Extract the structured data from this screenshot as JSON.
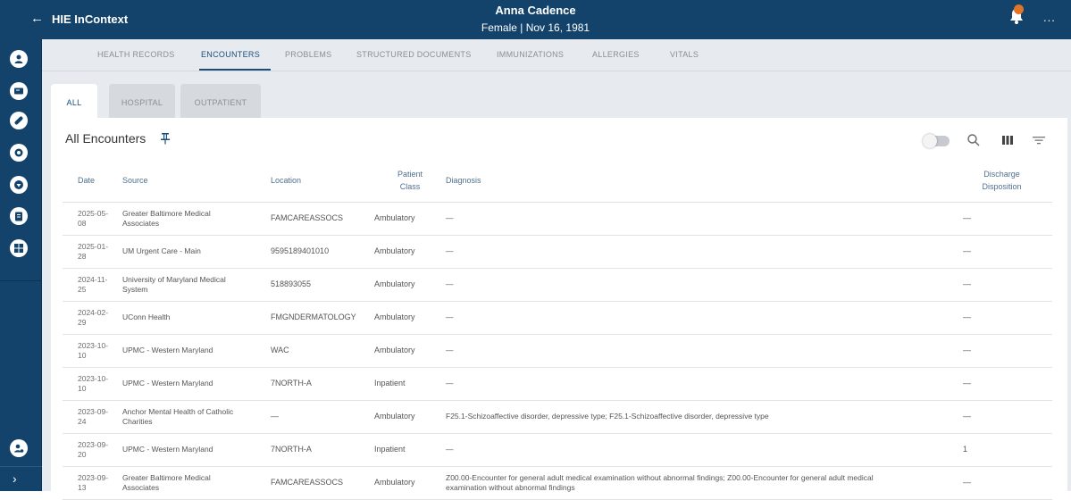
{
  "header": {
    "app_title": "HIE InContext",
    "patient_name": "Anna Cadence",
    "patient_meta": "Female | Nov 16, 1981",
    "more_label": "..."
  },
  "nav": {
    "tabs": [
      "HEALTH RECORDS",
      "ENCOUNTERS",
      "PROBLEMS",
      "STRUCTURED DOCUMENTS",
      "IMMUNIZATIONS",
      "ALLERGIES",
      "VITALS"
    ],
    "active": "ENCOUNTERS"
  },
  "subtabs": [
    "ALL",
    "HOSPITAL",
    "OUTPATIENT"
  ],
  "panel": {
    "title": "All Encounters"
  },
  "table": {
    "headers": {
      "date": "Date",
      "source": "Source",
      "location": "Location",
      "patient_class_1": "Patient",
      "patient_class_2": "Class",
      "diagnosis": "Diagnosis",
      "discharge_1": "Discharge",
      "discharge_2": "Disposition"
    },
    "rows": [
      {
        "date1": "2025-05-",
        "date2": "08",
        "source": "Greater Baltimore Medical Associates",
        "location": "FAMCAREASSOCS",
        "class": "Ambulatory",
        "diagnosis": "—",
        "disposition": "—"
      },
      {
        "date1": "2025-01-",
        "date2": "28",
        "source": "UM Urgent Care - Main",
        "location": "9595189401010",
        "class": "Ambulatory",
        "diagnosis": "—",
        "disposition": "—"
      },
      {
        "date1": "2024-11-",
        "date2": "25",
        "source": "University of Maryland Medical System",
        "location": "518893055",
        "class": "Ambulatory",
        "diagnosis": "—",
        "disposition": "—"
      },
      {
        "date1": "2024-02-",
        "date2": "29",
        "source": "UConn Health",
        "location": "FMGNDERMATOLOGY",
        "class": "Ambulatory",
        "diagnosis": "—",
        "disposition": "—"
      },
      {
        "date1": "2023-10-",
        "date2": "10",
        "source": "UPMC - Western Maryland",
        "location": "WAC",
        "class": "Ambulatory",
        "diagnosis": "—",
        "disposition": "—"
      },
      {
        "date1": "2023-10-",
        "date2": "10",
        "source": "UPMC - Western Maryland",
        "location": "7NORTH-A",
        "class": "Inpatient",
        "diagnosis": "—",
        "disposition": "—"
      },
      {
        "date1": "2023-09-",
        "date2": "24",
        "source": "Anchor Mental Health of Catholic Charities",
        "location": "—",
        "class": "Ambulatory",
        "diagnosis": "F25.1-Schizoaffective disorder, depressive type; F25.1-Schizoaffective disorder, depressive type",
        "disposition": "—"
      },
      {
        "date1": "2023-09-",
        "date2": "20",
        "source": "UPMC - Western Maryland",
        "location": "7NORTH-A",
        "class": "Inpatient",
        "diagnosis": "—",
        "disposition": "1"
      },
      {
        "date1": "2023-09-",
        "date2": "13",
        "source": "Greater Baltimore Medical Associates",
        "location": "FAMCAREASSOCS",
        "class": "Ambulatory",
        "diagnosis": "Z00.00-Encounter for general adult medical examination without abnormal findings; Z00.00-Encounter for general adult medical examination without abnormal findings",
        "disposition": "—"
      }
    ]
  },
  "colors": {
    "brand": "#13436b",
    "accent": "#1a4e7c",
    "badge": "#e2742a"
  },
  "icons": [
    "back-arrow-icon",
    "bell-icon",
    "more-icon",
    "pin-icon",
    "search-icon",
    "columns-icon",
    "filter-icon",
    "chevron-right-icon"
  ]
}
